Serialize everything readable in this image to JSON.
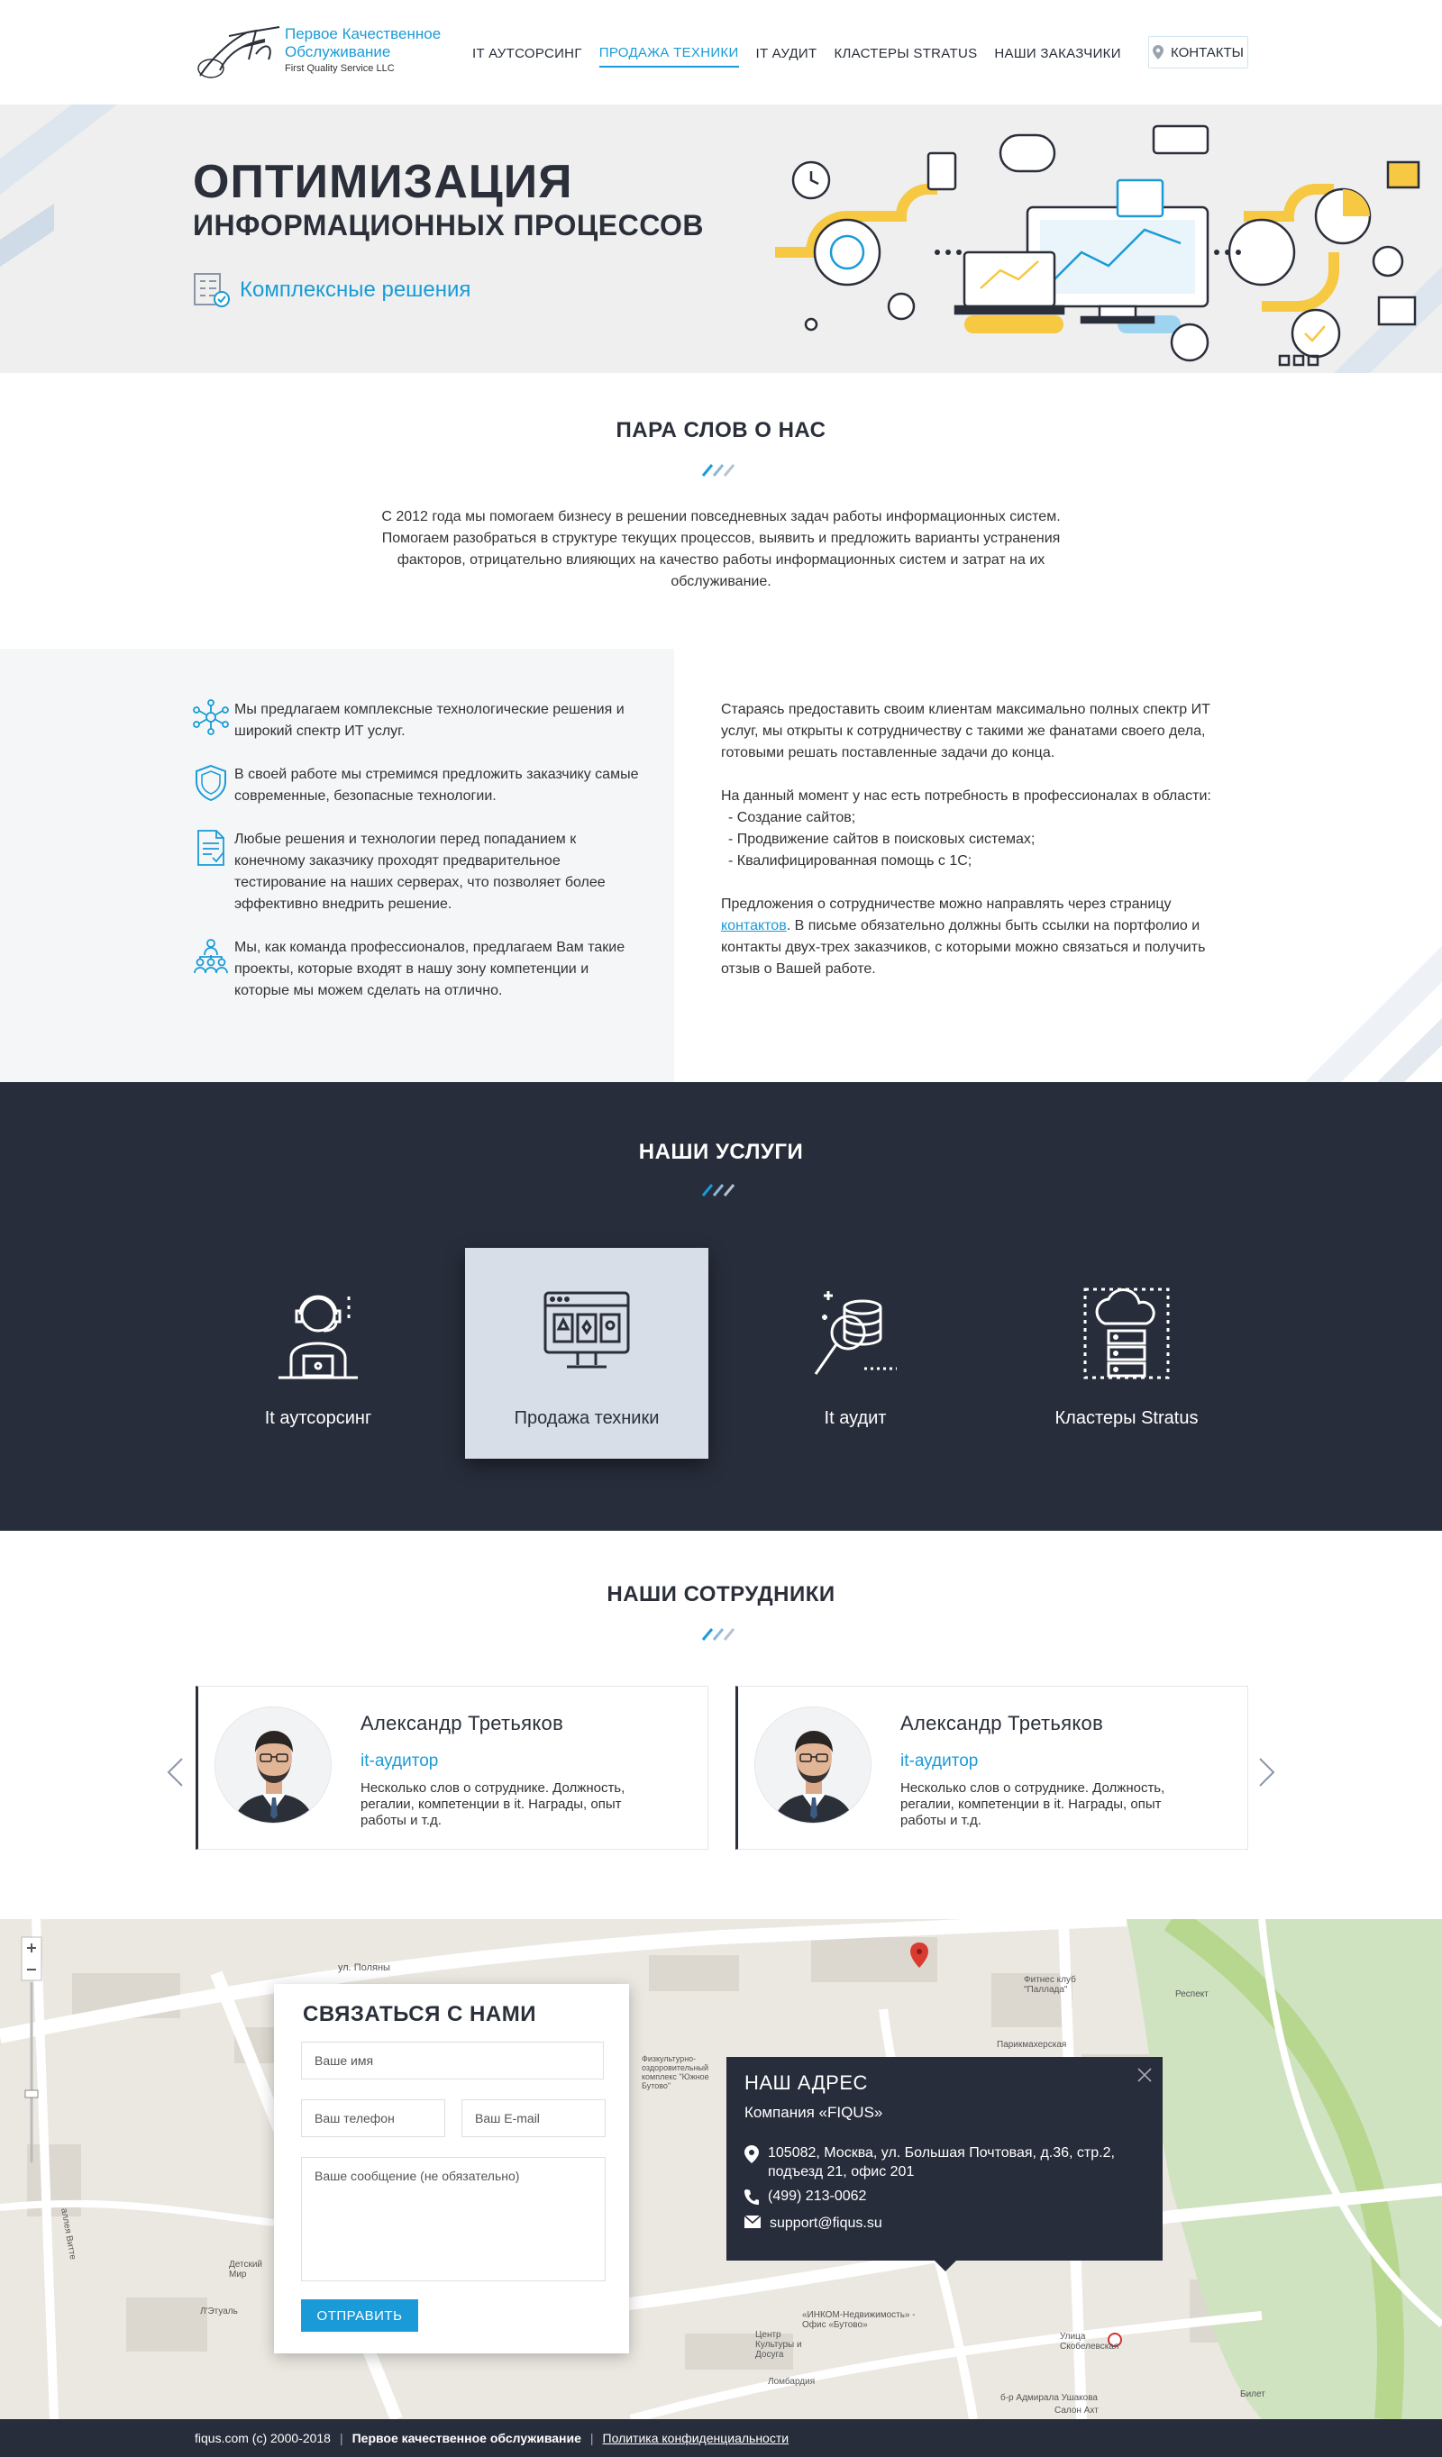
{
  "header": {
    "logo_line1": "Первое Качественное Обслуживание",
    "logo_line2": "First Quality Service LLC",
    "nav": [
      {
        "label": "IT АУТСОРСИНГ"
      },
      {
        "label": "ПРОДАЖА ТЕХНИКИ"
      },
      {
        "label": "IT АУДИТ"
      },
      {
        "label": "КЛАСТЕРЫ STRATUS"
      },
      {
        "label": "НАШИ ЗАКАЗЧИКИ"
      }
    ],
    "active_nav": "ПРОДАЖА ТЕХНИКИ",
    "contacts_label": "КОНТАКТЫ"
  },
  "hero": {
    "title_line1": "ОПТИМИЗАЦИЯ",
    "title_line2": "ИНФОРМАЦИОННЫХ ПРОЦЕССОВ",
    "subtitle": "Комплексные решения"
  },
  "about": {
    "title": "ПАРА СЛОВ О НАС",
    "text": "С 2012 года мы помогаем бизнесу в решении повседневных задач работы информационных систем. Помогаем разобраться в структуре текущих процессов, выявить и предложить варианты устранения факторов, отрицательно влияющих на качество работы информационных систем и затрат на их обслуживание."
  },
  "features": [
    {
      "icon": "network-icon",
      "text": "Мы предлагаем комплексные технологические решения и широкий спектр ИТ услуг."
    },
    {
      "icon": "shield-icon",
      "text": "В своей работе мы стремимся предложить заказчику самые современные, безопасные технологии."
    },
    {
      "icon": "document-check-icon",
      "text": "Любые решения и технологии перед попаданием к конечному заказчику проходят предварительное тестирование на наших серверах, что позволяет более эффективно внедрить решение."
    },
    {
      "icon": "team-icon",
      "text": "Мы, как команда профессионалов, предлагаем Вам такие проекты, которые входят в нашу зону компетенции и которые мы можем сделать на отлично."
    }
  ],
  "partners": {
    "p1": "Стараясь предоставить своим клиентам максимально полных спектр ИТ услуг, мы открыты к сотрудничеству с такими же фанатами своего дела, готовыми решать поставленные задачи до конца.",
    "p2": "На данный момент у нас есть потребность в профессионалах в области:",
    "items": [
      "- Создание сайтов;",
      "- Продвижение сайтов в поисковых системах;",
      "- Квалифицированная помощь с 1С;"
    ],
    "p3_before": "Предложения о сотрудничестве можно направлять через страницу ",
    "p3_link": "контактов",
    "p3_after": ". В письме обязательно должны быть ссылки на портфолио и контакты двух-трех заказчиков, с которыми можно связаться и получить отзыв о Вашей работе."
  },
  "services": {
    "title": "НАШИ УСЛУГИ",
    "items": [
      {
        "label": "It аутсорсинг",
        "icon": "operator-icon"
      },
      {
        "label": "Продажа техники",
        "icon": "computer-monitor-icon"
      },
      {
        "label": "It аудит",
        "icon": "database-search-icon"
      },
      {
        "label": "Кластеры Stratus",
        "icon": "cloud-server-icon"
      }
    ],
    "active": "Продажа техники"
  },
  "team": {
    "title": "НАШИ СОТРУДНИКИ",
    "members": [
      {
        "name": "Александр Третьяков",
        "role": "it-аудитор",
        "desc": "Несколько слов о сотруднике. Должность, регалии, компетенции в it. Награды, опыт работы и т.д."
      },
      {
        "name": "Александр Третьяков",
        "role": "it-аудитор",
        "desc": "Несколько слов о сотруднике. Должность, регалии, компетенции в it. Награды, опыт работы и т.д."
      }
    ]
  },
  "contact_form": {
    "title": "СВЯЗАТЬСЯ С НАМИ",
    "name_placeholder": "Ваше имя",
    "phone_placeholder": "Ваш телефон",
    "email_placeholder": "Ваш E-mail",
    "message_placeholder": "Ваше сообщение (не обязательно)",
    "submit_label": "ОТПРАВИТЬ"
  },
  "address": {
    "title": "НАШ АДРЕС",
    "company": "Компания «FIQUS»",
    "street": "105082, Москва, ул. Большая Почтовая, д.36, стр.2, подъезд 21, офис 201",
    "phone": "(499) 213-0062",
    "email": "support@fiqus.su"
  },
  "map_labels": {
    "street1": "ул. Поляны",
    "street2": "Фитнес клуб \"Палладa\"",
    "street3": "Парикмахерская",
    "street4": "Физкультурно-оздоровительный комплекс \"Южное Бутово\"",
    "street5": "Детский Мир",
    "street6": "Л'Этуаль",
    "street7": "«ИНКОМ-Недвижимость» - Офис «Бутово»",
    "street8": "Центр Культуры и Досуга",
    "street9": "Ломбардия",
    "street10": "Улица Скобелевская",
    "street11": "б-р Адмирала Ушакова",
    "street12": "Респект",
    "street13": "Салон Ахт",
    "street14": "Билет",
    "street15": "аллея Витте"
  },
  "footer": {
    "copyright": "fiqus.com  (c)  2000-2018",
    "company": "Первое качественное обслуживание",
    "policy": "Политика конфиденциальности"
  },
  "colors": {
    "accent": "#1a9bd7",
    "dark": "#282d3b",
    "hero_bg": "#efefef",
    "yellow": "#f7c842"
  }
}
